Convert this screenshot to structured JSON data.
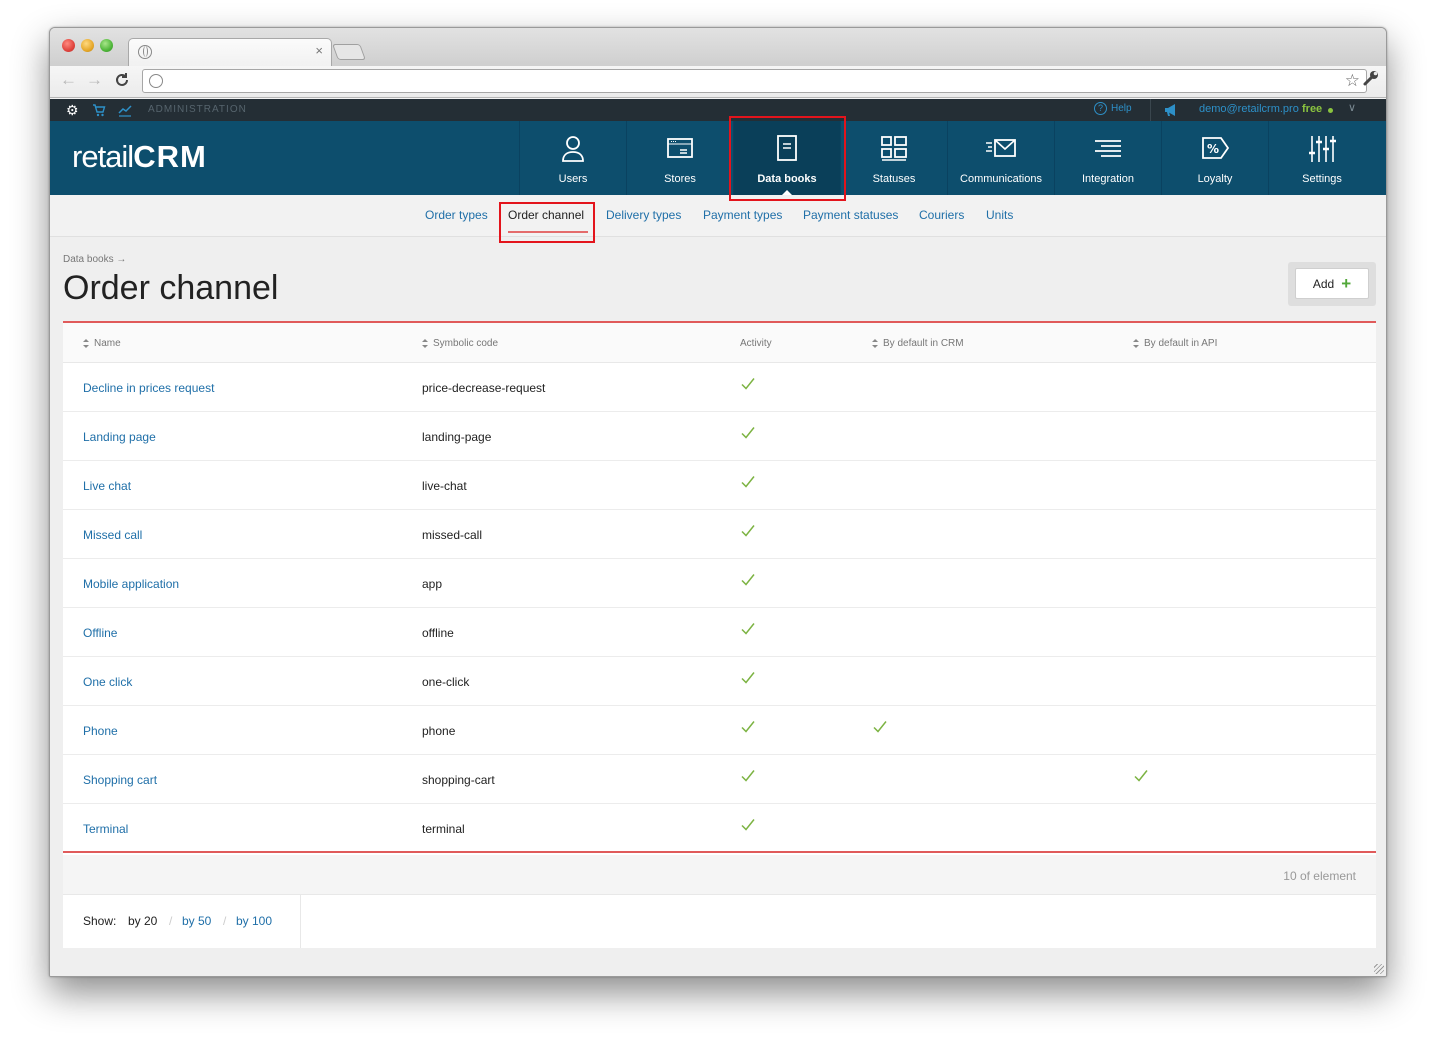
{
  "browser": {
    "tab_close": "×",
    "back": "←",
    "forward": "→",
    "reload": "C",
    "bookmark": "☆"
  },
  "admin_bar": {
    "label": "ADMINISTRATION",
    "help": "Help",
    "help_mark": "?",
    "email": "demo@retailcrm.pro",
    "plan": "free",
    "chevron": "∨"
  },
  "logo": {
    "part1": "retail",
    "part2": "CRM"
  },
  "main_nav": [
    {
      "label": "Users",
      "icon": "user-icon"
    },
    {
      "label": "Stores",
      "icon": "store-icon"
    },
    {
      "label": "Data books",
      "icon": "data-book-icon",
      "active": true
    },
    {
      "label": "Statuses",
      "icon": "statuses-icon"
    },
    {
      "label": "Communications",
      "icon": "communications-icon"
    },
    {
      "label": "Integration",
      "icon": "integration-icon"
    },
    {
      "label": "Loyalty",
      "icon": "loyalty-icon"
    },
    {
      "label": "Settings",
      "icon": "settings-icon"
    }
  ],
  "sub_nav": [
    {
      "label": "Order types"
    },
    {
      "label": "Order channel",
      "active": true
    },
    {
      "label": "Delivery types"
    },
    {
      "label": "Payment types"
    },
    {
      "label": "Payment statuses"
    },
    {
      "label": "Couriers"
    },
    {
      "label": "Units"
    }
  ],
  "page": {
    "breadcrumb": "Data books →",
    "title": "Order channel",
    "add_button": "Add",
    "add_plus": "+"
  },
  "table": {
    "columns": [
      "Name",
      "Symbolic code",
      "Activity",
      "By default in CRM",
      "By default in API"
    ],
    "rows": [
      {
        "name": "Decline in prices request",
        "code": "price-decrease-request",
        "active": true,
        "default_crm": false,
        "default_api": false
      },
      {
        "name": "Landing page",
        "code": "landing-page",
        "active": true,
        "default_crm": false,
        "default_api": false
      },
      {
        "name": "Live chat",
        "code": "live-chat",
        "active": true,
        "default_crm": false,
        "default_api": false
      },
      {
        "name": "Missed call",
        "code": "missed-call",
        "active": true,
        "default_crm": false,
        "default_api": false
      },
      {
        "name": "Mobile application",
        "code": "app",
        "active": true,
        "default_crm": false,
        "default_api": false
      },
      {
        "name": "Offline",
        "code": "offline",
        "active": true,
        "default_crm": false,
        "default_api": false
      },
      {
        "name": "One click",
        "code": "one-click",
        "active": true,
        "default_crm": false,
        "default_api": false
      },
      {
        "name": "Phone",
        "code": "phone",
        "active": true,
        "default_crm": true,
        "default_api": false
      },
      {
        "name": "Shopping cart",
        "code": "shopping-cart",
        "active": true,
        "default_crm": false,
        "default_api": true
      },
      {
        "name": "Terminal",
        "code": "terminal",
        "active": true,
        "default_crm": false,
        "default_api": false
      }
    ],
    "count_text": "10  of element"
  },
  "pager": {
    "label": "Show:",
    "options": [
      "by 20",
      "by 50",
      "by 100"
    ],
    "separator": "/",
    "selected_index": 0
  },
  "colors": {
    "header_bg": "#0d4e6d",
    "link": "#1f6fa8",
    "check": "#7cb342",
    "accent_red": "#e3141c"
  }
}
